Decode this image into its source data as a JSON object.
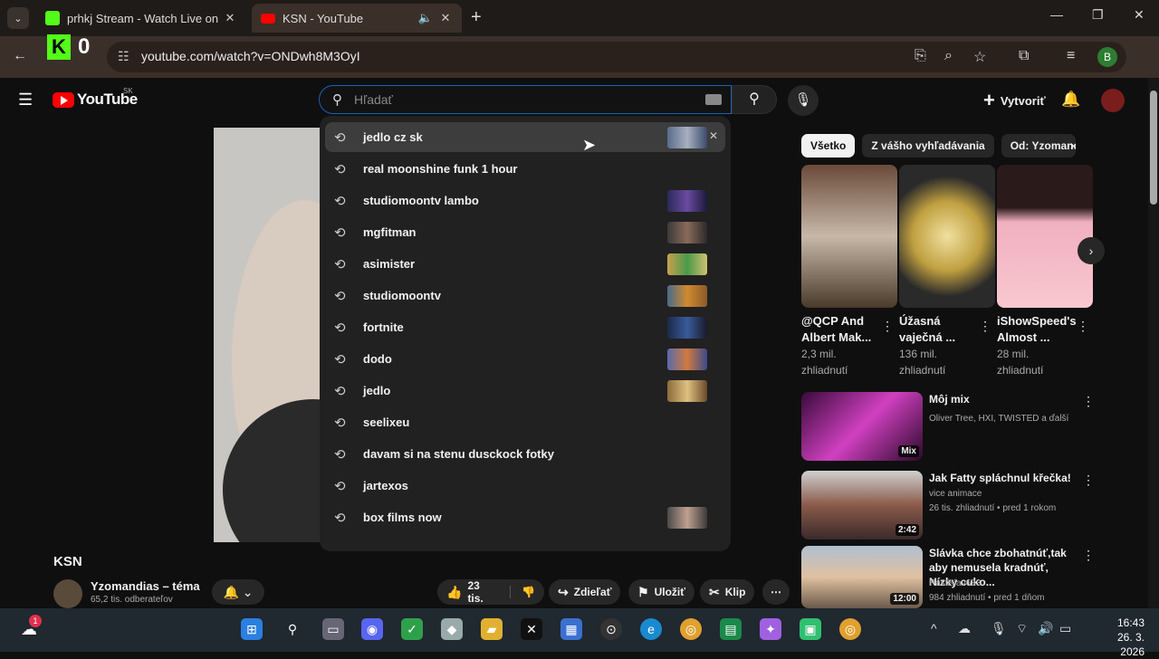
{
  "browser": {
    "tabs": [
      {
        "title": "prhkj Stream - Watch Live on K",
        "active": false
      },
      {
        "title": "KSN - YouTube",
        "active": true
      }
    ],
    "url": "youtube.com/watch?v=ONDwh8M3OyI",
    "profile_initial": "B"
  },
  "extension": {
    "kick_letter": "K",
    "kick_count": "0"
  },
  "youtube": {
    "logo_text": "YouTube",
    "country_code": "SK",
    "search_placeholder": "Hľadať",
    "create_label": "Vytvoriť",
    "suggestions": [
      "jedlo cz sk",
      "real moonshine funk 1 hour",
      "studiomoontv lambo",
      "mgfitman",
      "asimister",
      "studiomoontv",
      "fortnite",
      "dodo",
      "jedlo",
      "seelixeu",
      "davam si na stenu dusckock fotky",
      "jartexos",
      "box films now"
    ],
    "chips": [
      "Všetko",
      "Z vášho vyhľadávania",
      "Od: Yzomandia"
    ],
    "shorts": [
      {
        "title": "@QCP And Albert Mak...",
        "views": "2,3 mil. zhliadnutí"
      },
      {
        "title": "Úžasná vaječná ...",
        "views": "136 mil. zhliadnutí"
      },
      {
        "title": "iShowSpeed's Almost ...",
        "views": "28 mil. zhliadnutí"
      }
    ],
    "recommended": [
      {
        "title": "Môj mix",
        "channel": "Oliver Tree, HXI, TWISTED a ďalší",
        "meta": "",
        "badge": "Mix"
      },
      {
        "title": "Jak Fatty spláchnul křečka!",
        "channel": "vice animace",
        "meta": "26 tis. zhliadnutí • pred 1 rokom",
        "badge": "2:42"
      },
      {
        "title": "Slávka chce zbohatnúť,tak aby nemusela kradnúť, Nízky cuko...",
        "channel": "Rastislav633",
        "meta": "984 zhliadnutí • pred 1 dňom",
        "badge": "12:00"
      }
    ],
    "video": {
      "title": "KSN",
      "channel": "Yzomandias – téma",
      "subscribers": "65,2 tis. odberateľov",
      "likes": "23 tis.",
      "share_label": "Zdieľať",
      "save_label": "Uložiť",
      "clip_label": "Klip"
    }
  },
  "system": {
    "time": "16:43",
    "date": "26. 3. 2026",
    "notif_count": "1"
  },
  "colors": {
    "accent": "#1c62b9",
    "brand_red": "#ff0000",
    "kick_green": "#53fc18"
  }
}
